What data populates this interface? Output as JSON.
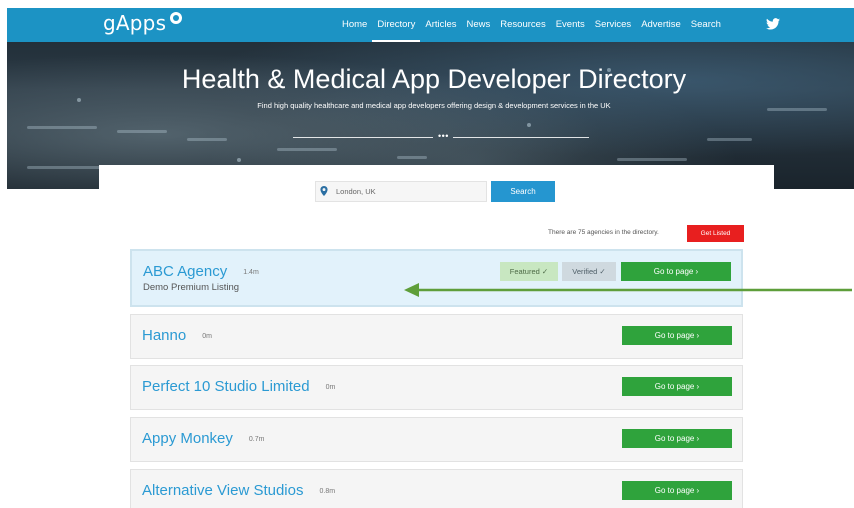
{
  "header": {
    "logo": "gApps",
    "nav": [
      "Home",
      "Directory",
      "Articles",
      "News",
      "Resources",
      "Events",
      "Services",
      "Advertise",
      "Search"
    ],
    "active_nav": "Directory"
  },
  "hero": {
    "title": "Health & Medical App Developer Directory",
    "subtitle": "Find high quality healthcare and medical app developers offering design & development services in the UK",
    "divider_dots": "•••"
  },
  "search": {
    "location_value": "London, UK",
    "button_label": "Search"
  },
  "directory": {
    "count_text": "There are 75 agencies in the directory.",
    "get_listed_label": "Get Listed",
    "go_label": "Go to page  ›",
    "listings": [
      {
        "name": "ABC Agency",
        "distance": "1.4m",
        "description": "Demo Premium Listing",
        "featured_label": "Featured ✓",
        "verified_label": "Verified ✓"
      },
      {
        "name": "Hanno",
        "distance": "0m"
      },
      {
        "name": "Perfect 10 Studio Limited",
        "distance": "0m"
      },
      {
        "name": "Appy Monkey",
        "distance": "0.7m"
      },
      {
        "name": "Alternative View Studios",
        "distance": "0.8m"
      }
    ]
  },
  "colors": {
    "nav_bar": "#1c93c4",
    "link_blue": "#2b9ad3",
    "go_button": "#2fa33c",
    "get_listed": "#e81f1f",
    "arrow": "#5e9e3a"
  },
  "icons": [
    "logo-mark-icon",
    "twitter-icon",
    "location-pin-icon",
    "chevron-right-icon",
    "checkmark-icon",
    "annotation-arrow"
  ]
}
